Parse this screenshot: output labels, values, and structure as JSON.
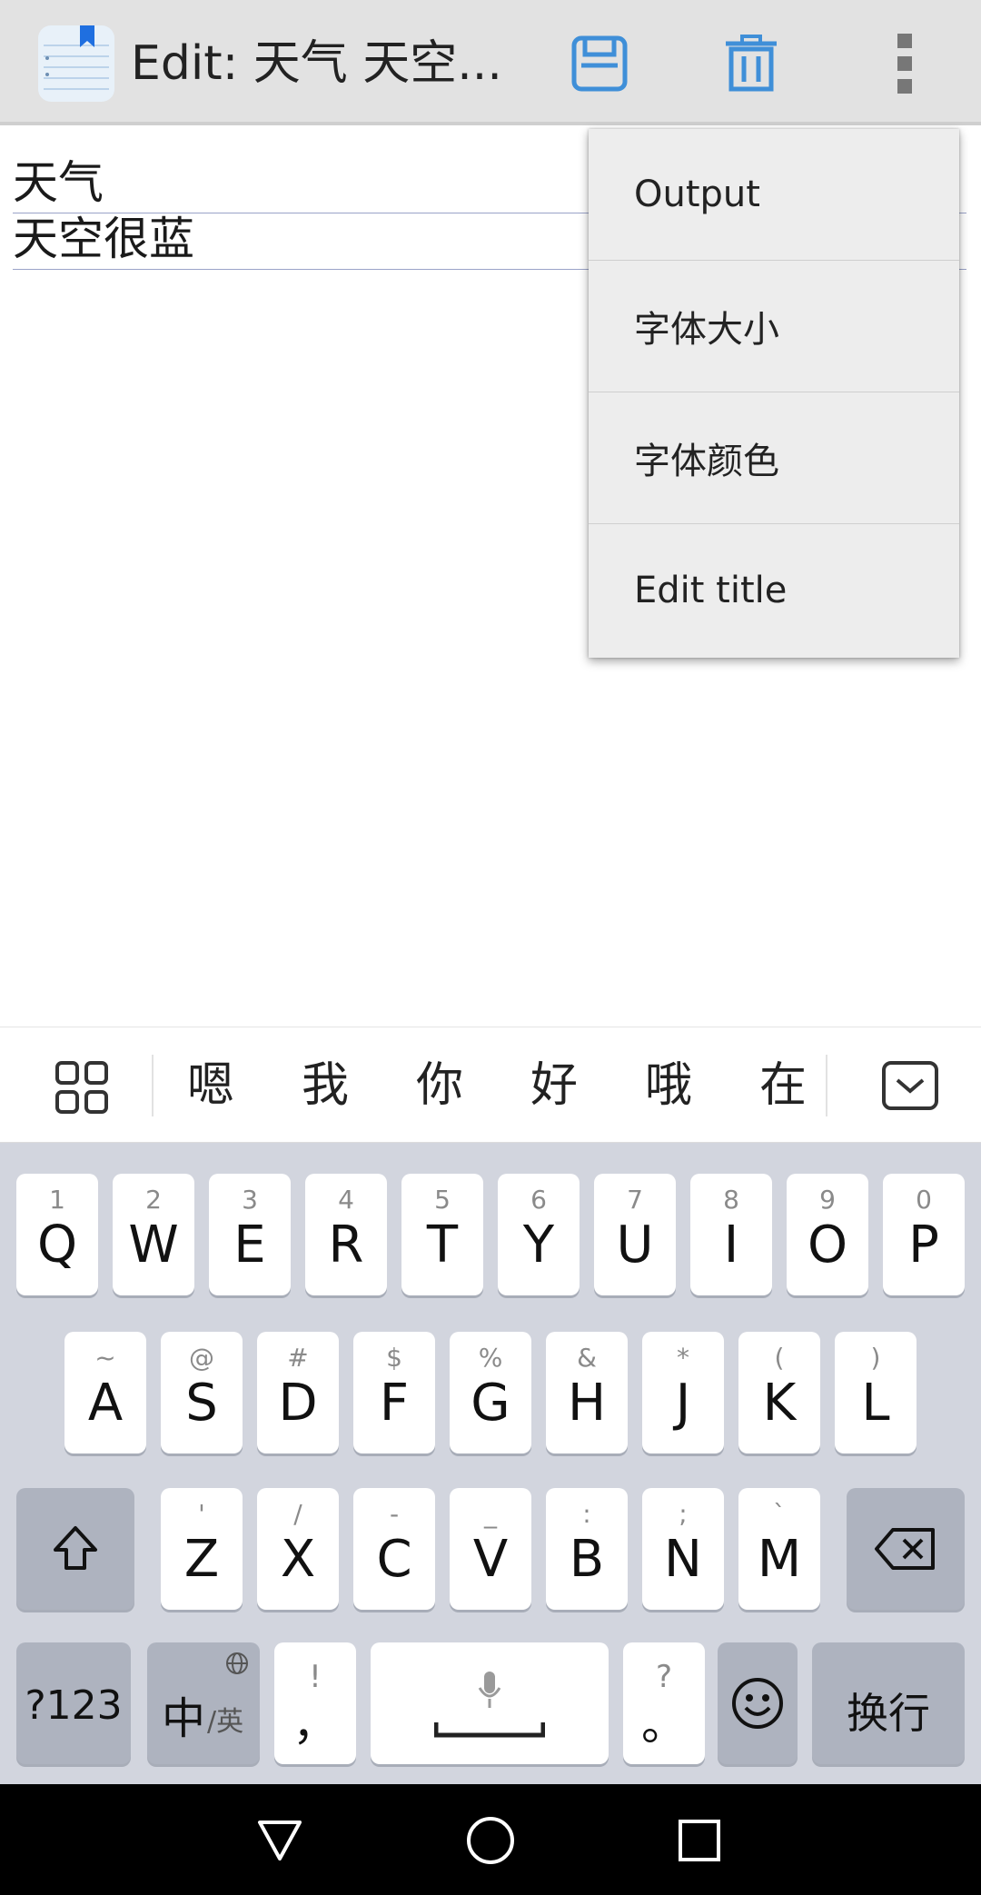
{
  "app_bar": {
    "title": "Edit: 天气 天空...",
    "icons": [
      "notebook-app-icon",
      "save-icon",
      "delete-icon",
      "more-vert-icon"
    ],
    "accent_color": "#3f8fd8"
  },
  "editor": {
    "lines": [
      "天气",
      "天空很蓝"
    ]
  },
  "overflow_menu": {
    "items": [
      "Output",
      "字体大小",
      "字体颜色",
      "Edit title"
    ]
  },
  "candidate_bar": {
    "candidates": [
      "嗯",
      "我",
      "你",
      "好",
      "哦",
      "在"
    ]
  },
  "keyboard": {
    "row1": [
      {
        "hint": "1",
        "key": "Q"
      },
      {
        "hint": "2",
        "key": "W"
      },
      {
        "hint": "3",
        "key": "E"
      },
      {
        "hint": "4",
        "key": "R"
      },
      {
        "hint": "5",
        "key": "T"
      },
      {
        "hint": "6",
        "key": "Y"
      },
      {
        "hint": "7",
        "key": "U"
      },
      {
        "hint": "8",
        "key": "I"
      },
      {
        "hint": "9",
        "key": "O"
      },
      {
        "hint": "0",
        "key": "P"
      }
    ],
    "row2": [
      {
        "hint": "~",
        "key": "A"
      },
      {
        "hint": "@",
        "key": "S"
      },
      {
        "hint": "#",
        "key": "D"
      },
      {
        "hint": "$",
        "key": "F"
      },
      {
        "hint": "%",
        "key": "G"
      },
      {
        "hint": "&",
        "key": "H"
      },
      {
        "hint": "*",
        "key": "J"
      },
      {
        "hint": "(",
        "key": "K"
      },
      {
        "hint": ")",
        "key": "L"
      }
    ],
    "row3": [
      {
        "hint": "'",
        "key": "Z"
      },
      {
        "hint": "/",
        "key": "X"
      },
      {
        "hint": "-",
        "key": "C"
      },
      {
        "hint": "_",
        "key": "V"
      },
      {
        "hint": ":",
        "key": "B"
      },
      {
        "hint": ";",
        "key": "N"
      },
      {
        "hint": "`",
        "key": "M"
      }
    ],
    "symbols_key": "?123",
    "lang_key_main": "中",
    "lang_key_sub": "/英",
    "comma_key": {
      "hint": "!",
      "key": "，"
    },
    "period_key": {
      "hint": "?",
      "key": "。"
    },
    "enter_key": "换行"
  }
}
